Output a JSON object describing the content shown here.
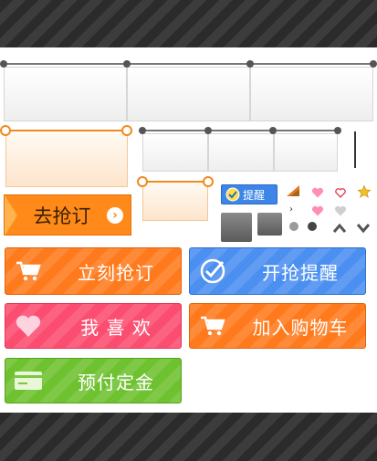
{
  "buttons": {
    "qiang_ding": "去抢订",
    "qiang_ding_icon": "chevron-right-circle-icon",
    "remind_small": "提醒",
    "buy_now": "立刻抢订",
    "start_remind": "开抢提醒",
    "like": "我 喜 欢",
    "add_cart": "加入购物车",
    "prepay": "预付定金"
  },
  "icons": {
    "cart": "cart-icon",
    "check": "check-circle-icon",
    "heart": "heart-icon",
    "card": "card-icon",
    "star": "star-icon",
    "chevron_up": "chevron-up-icon",
    "chevron_down": "chevron-down-icon"
  },
  "colors": {
    "orange": "#ff7a1c",
    "blue": "#4b8ff0",
    "pink": "#fb4d70",
    "green": "#6ec12f",
    "stripe_dark": "#2b2b2b"
  }
}
